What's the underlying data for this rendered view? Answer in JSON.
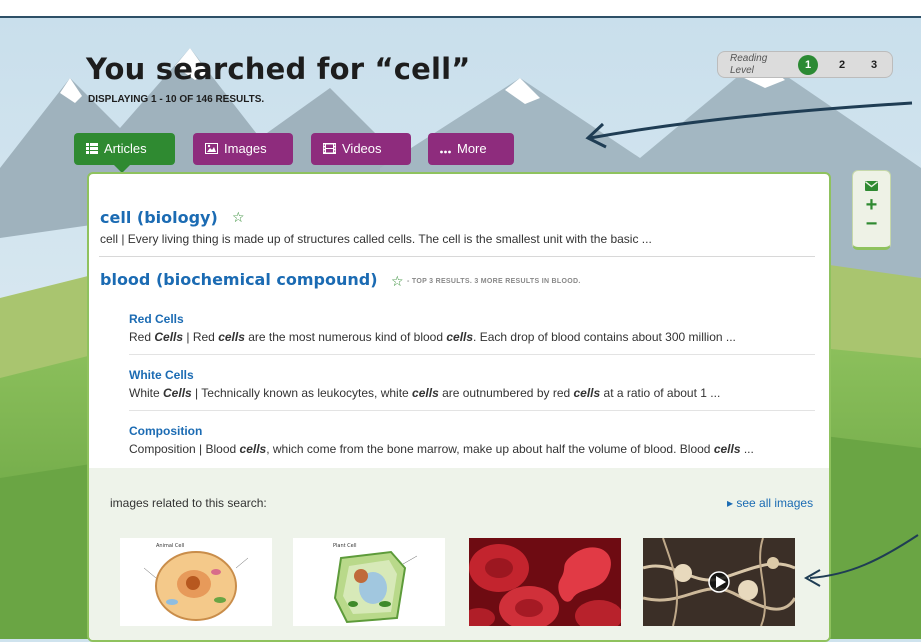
{
  "search": {
    "heading": "You searched for “cell”",
    "results_summary": "DISPLAYING 1 - 10 OF 146 RESULTS."
  },
  "reading_level": {
    "label": "Reading Level",
    "levels": [
      "1",
      "2",
      "3"
    ],
    "active": "1"
  },
  "tabs": [
    {
      "label": "Articles",
      "icon": "list-icon",
      "active": true
    },
    {
      "label": "Images",
      "icon": "image-icon",
      "active": false
    },
    {
      "label": "Videos",
      "icon": "film-icon",
      "active": false
    },
    {
      "label": "More",
      "icon": "more-icon",
      "active": false
    }
  ],
  "tools": {
    "email_icon": "envelope-icon",
    "zoom_in": "+",
    "zoom_out": "−"
  },
  "results": [
    {
      "title": "cell (biology)",
      "description": "cell  |  Every living thing is made up of structures called cells. The cell is the smallest unit with the basic ..."
    },
    {
      "title": "blood (biochemical compound)",
      "note": "- TOP 3 RESULTS. 3 MORE RESULTS IN BLOOD.",
      "subresults": [
        {
          "title": "Red Cells",
          "description": "Red Cells  | Red cells are the most numerous kind of blood cells. Each drop of blood contains about 300 million ..."
        },
        {
          "title": "White Cells",
          "description": "White Cells  | Technically known as leukocytes, white cells are outnumbered by red cells at a ratio of about 1 ..."
        },
        {
          "title": "Composition",
          "description": "Composition  | Blood cells, which come from the bone marrow, make up about half the volume of blood. Blood cells ..."
        }
      ]
    }
  ],
  "images": {
    "label": "images related to this search:",
    "see_all": "see all images",
    "thumbnails": [
      {
        "name": "animal-cell-diagram",
        "title": "Animal Cell"
      },
      {
        "name": "plant-cell-diagram",
        "title": "Plant Cell"
      },
      {
        "name": "red-blood-cells-photo"
      },
      {
        "name": "nerve-cells-video-thumbnail"
      }
    ]
  },
  "colors": {
    "tab_active": "#2f8a31",
    "tab_inactive": "#8e2c7d",
    "link": "#1b6bb3",
    "panel_border": "#8fc25e"
  }
}
